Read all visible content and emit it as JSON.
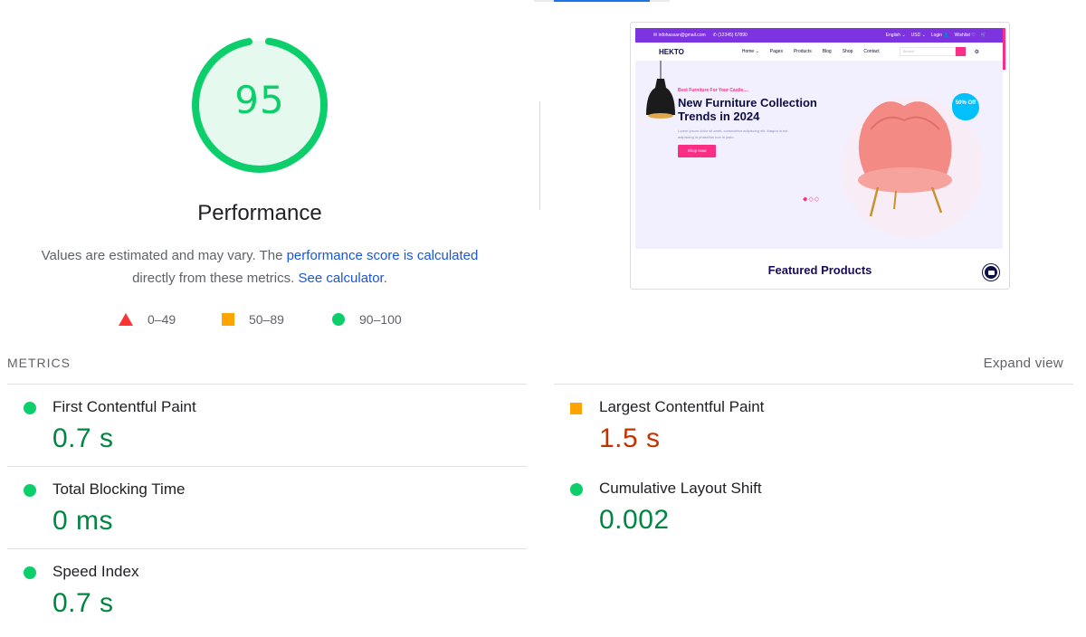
{
  "gauge": {
    "score": "95",
    "fraction": 0.95,
    "color": "#0cce6b"
  },
  "performance": {
    "title": "Performance",
    "desc_prefix": "Values are estimated and may vary. The ",
    "score_link": "performance score is calculated",
    "desc_middle": "directly from these metrics. ",
    "calc_link": "See calculator",
    "desc_suffix": "."
  },
  "legend": [
    {
      "range": "0–49",
      "shape": "triangle",
      "color": "#ff3333"
    },
    {
      "range": "50–89",
      "shape": "square",
      "color": "#ffa400"
    },
    {
      "range": "90–100",
      "shape": "circle",
      "color": "#0cce6b"
    }
  ],
  "preview": {
    "email": "infohassan@gmail.com",
    "phone": "(12345) 67890",
    "top_right": [
      "English ⌄",
      "USD ⌄",
      "Login 👤",
      "Wishlist ♡",
      "🛒"
    ],
    "logo": "HEKTO",
    "menu": [
      "Home ⌄",
      "Pages",
      "Products",
      "Blog",
      "Shop",
      "Contact"
    ],
    "search_placeholder": "Search",
    "sub": "Best Furniture For Your Castle....",
    "headline": "New Furniture Collection Trends in 2024",
    "paragraph": "Lorem ipsum dolor sit amet, consectetur adipiscing elit. Magna in est adipiscing in phasellus non in justo.",
    "button": "Shop Now",
    "badge": "50% Off",
    "featured": "Featured Products"
  },
  "metrics": {
    "heading": "METRICS",
    "expand": "Expand view",
    "items": [
      {
        "label": "First Contentful Paint",
        "value": "0.7 s",
        "status": "good"
      },
      {
        "label": "Largest Contentful Paint",
        "value": "1.5 s",
        "status": "average"
      },
      {
        "label": "Total Blocking Time",
        "value": "0 ms",
        "status": "good"
      },
      {
        "label": "Cumulative Layout Shift",
        "value": "0.002",
        "status": "good"
      },
      {
        "label": "Speed Index",
        "value": "0.7 s",
        "status": "good"
      }
    ]
  },
  "colors": {
    "good": "#0cce6b",
    "average": "#ffa400",
    "poor": "#ff3333",
    "link": "#1a56db"
  }
}
